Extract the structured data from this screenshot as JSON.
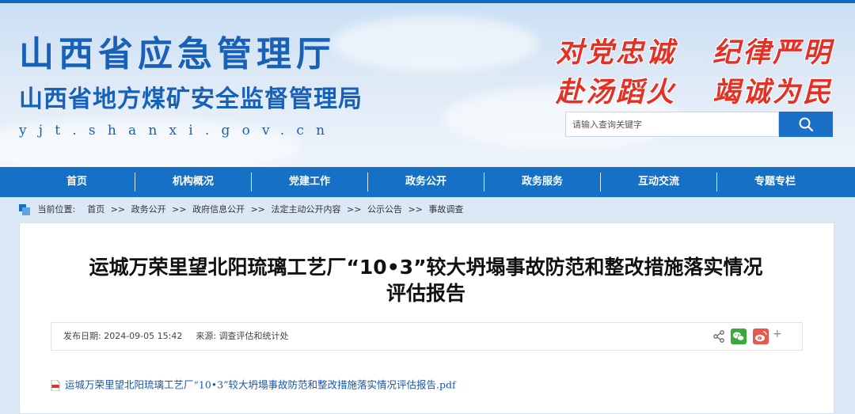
{
  "header": {
    "title_main": "山西省应急管理厅",
    "title_sub": "山西省地方煤矿安全监督管理局",
    "domain": "yjt.shanxi.gov.cn",
    "slogans": [
      "对党忠诚",
      "纪律严明",
      "赴汤蹈火",
      "竭诚为民"
    ],
    "search": {
      "placeholder": "请输入查询关键字",
      "value": "",
      "button_icon": "search-icon"
    },
    "colors": {
      "title": "#1761b8",
      "slogan": "#e23226"
    }
  },
  "nav": {
    "items": [
      "首页",
      "机构概况",
      "党建工作",
      "政务公开",
      "政务服务",
      "互动交流",
      "专题专栏"
    ],
    "color": "#1570c6"
  },
  "breadcrumb": {
    "label": "当前位置:",
    "separator": ">>",
    "items": [
      "首页",
      "政务公开",
      "政府信息公开",
      "法定主动公开内容",
      "公示公告",
      "事故调查"
    ]
  },
  "article": {
    "title_line1": "运城万荣里望北阳琉璃工艺厂“10•3”较大坍塌事故防范和整改措施落实情况",
    "title_line2": "评估报告",
    "meta": {
      "date_label": "发布日期:",
      "date": "2024-09-05 15:42",
      "source_label": "来源:",
      "source": "调查评估和统计处"
    },
    "share_icons": [
      "share-icon",
      "wechat-icon",
      "weibo-icon"
    ],
    "share_more": "+",
    "attachment": "运城万荣里望北阳琉璃工艺厂“10•3”较大坍塌事故防范和整改措施落实情况评估报告.pdf"
  }
}
